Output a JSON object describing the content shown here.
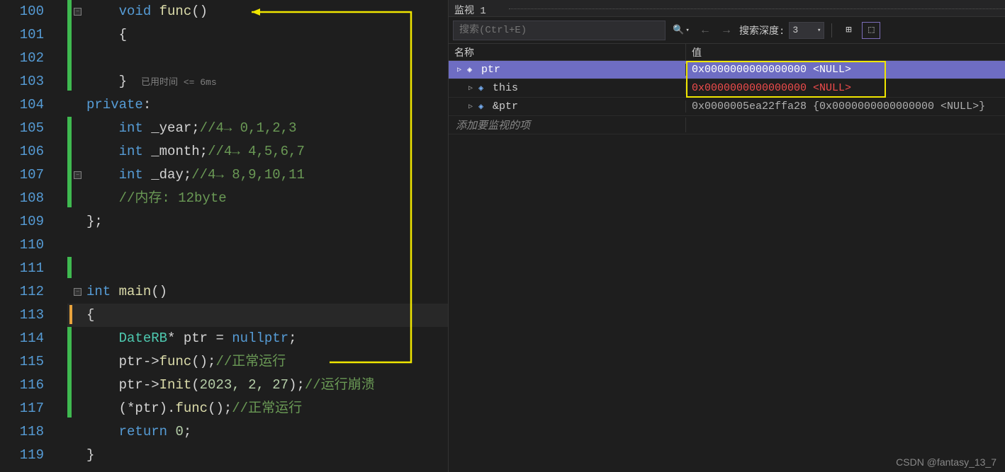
{
  "editor": {
    "lines": [
      {
        "num": "100"
      },
      {
        "num": "101"
      },
      {
        "num": "102"
      },
      {
        "num": "103"
      },
      {
        "num": "104"
      },
      {
        "num": "105"
      },
      {
        "num": "106"
      },
      {
        "num": "107"
      },
      {
        "num": "108"
      },
      {
        "num": "109"
      },
      {
        "num": "110"
      },
      {
        "num": "111"
      },
      {
        "num": "112"
      },
      {
        "num": "113"
      },
      {
        "num": "114"
      },
      {
        "num": "115"
      },
      {
        "num": "116"
      },
      {
        "num": "117"
      },
      {
        "num": "118"
      },
      {
        "num": "119"
      }
    ],
    "tokens": {
      "void": "void",
      "func": "func",
      "int_kw": "int",
      "private": "private",
      "year": "_year",
      "month": "_month",
      "day": "_day",
      "main": "main",
      "DateRB": "DateRB",
      "ptr": "ptr",
      "nullptr": "nullptr",
      "Init": "Init",
      "return_kw": "return",
      "c1": "//4→ 0,1,2,3",
      "c2": "//4→ 4,5,6,7",
      "c3": "//4→ 8,9,10,11",
      "c4": "//内存: 12byte",
      "run_ok": "//正常运行",
      "run_crash": "//运行崩溃",
      "nums": "2023, 2, 27"
    },
    "hint": "已用时间 <= 6ms"
  },
  "watch": {
    "title": "监视 1",
    "search_placeholder": "搜索(Ctrl+E)",
    "depth_label": "搜索深度:",
    "depth_value": "3",
    "col_name": "名称",
    "col_value": "值",
    "rows": [
      {
        "name": "ptr",
        "value": "0x0000000000000000 <NULL>",
        "selected": true,
        "error": true
      },
      {
        "name": "this",
        "value": "0x0000000000000000 <NULL>",
        "error": true
      },
      {
        "name": "&ptr",
        "value": "0x0000005ea22ffa28 {0x0000000000000000 <NULL>}"
      }
    ],
    "add_item": "添加要监视的项"
  },
  "watermark": "CSDN @fantasy_13_7"
}
